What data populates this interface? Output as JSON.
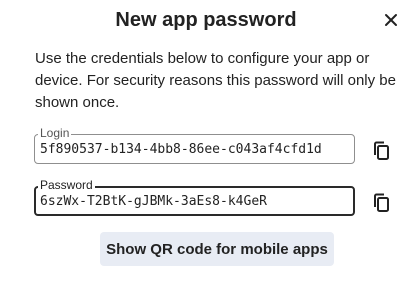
{
  "dialog": {
    "title": "New app password",
    "description": "Use the credentials below to configure your app or device. For security reasons this password will only be shown once.",
    "close_icon": "close-icon"
  },
  "login": {
    "label": "Login",
    "value": "5f890537-b134-4bb8-86ee-c043af4cfd1d",
    "copy_icon": "copy-icon"
  },
  "password": {
    "label": "Password",
    "value": "6szWx-T2BtK-gJBMk-3aEs8-k4GeR",
    "copy_icon": "copy-icon"
  },
  "qr_button": {
    "label": "Show QR code for mobile apps"
  }
}
